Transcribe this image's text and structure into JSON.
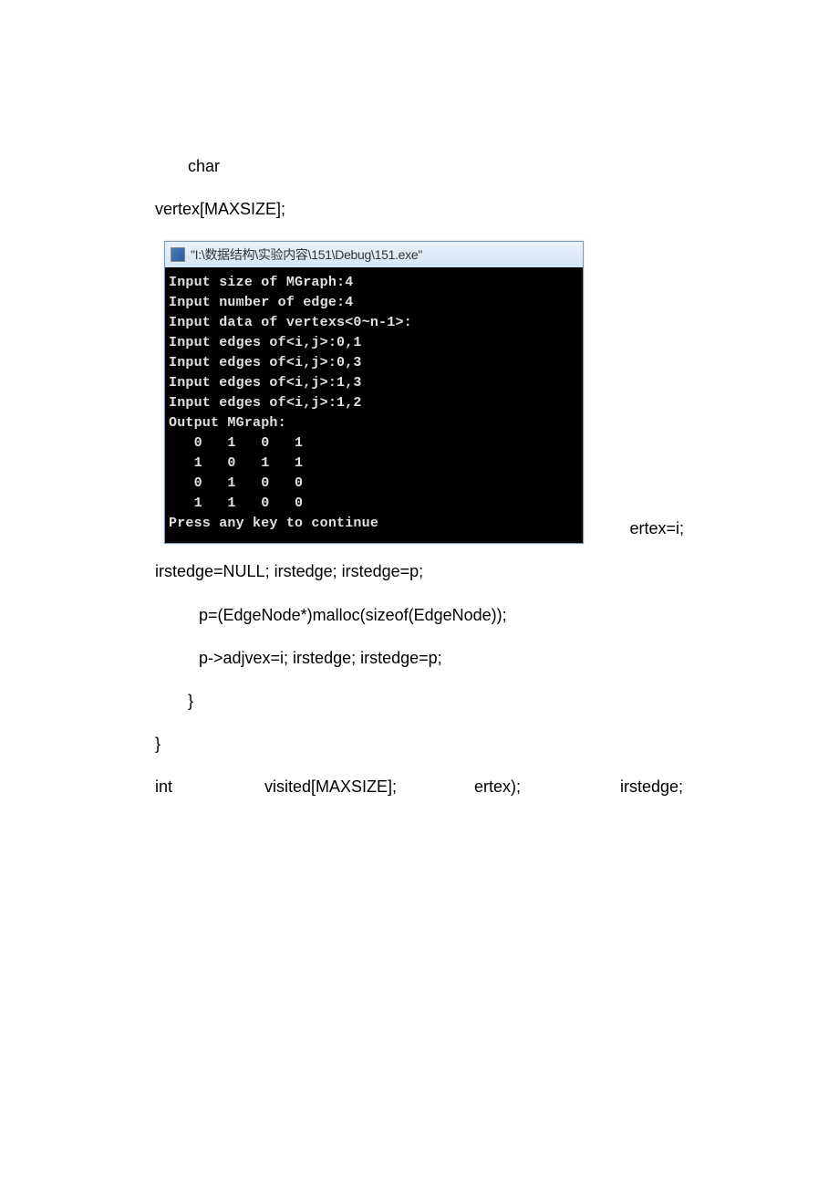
{
  "code": {
    "l1": "char",
    "l2": "vertex[MAXSIZE];",
    "l3": "ertex=i;",
    "l4": "irstedge=NULL; irstedge; irstedge=p;",
    "l5": "p=(EdgeNode*)malloc(sizeof(EdgeNode));",
    "l6": "p->adjvex=i; irstedge; irstedge=p;",
    "l7": "}",
    "l8": "}",
    "l9a": "int",
    "l9b": "visited[MAXSIZE];",
    "l9c": "ertex);",
    "l9d": "irstedge;"
  },
  "console": {
    "title": "\"I:\\数据结构\\实验内容\\151\\Debug\\151.exe\"",
    "lines": [
      "Input size of MGraph:4",
      "Input number of edge:4",
      "Input data of vertexs<0~n-1>:",
      "Input edges of<i,j>:0,1",
      "Input edges of<i,j>:0,3",
      "Input edges of<i,j>:1,3",
      "Input edges of<i,j>:1,2",
      "Output MGraph:",
      "   0   1   0   1",
      "   1   0   1   1",
      "   0   1   0   0",
      "   1   1   0   0",
      "Press any key to continue"
    ]
  }
}
